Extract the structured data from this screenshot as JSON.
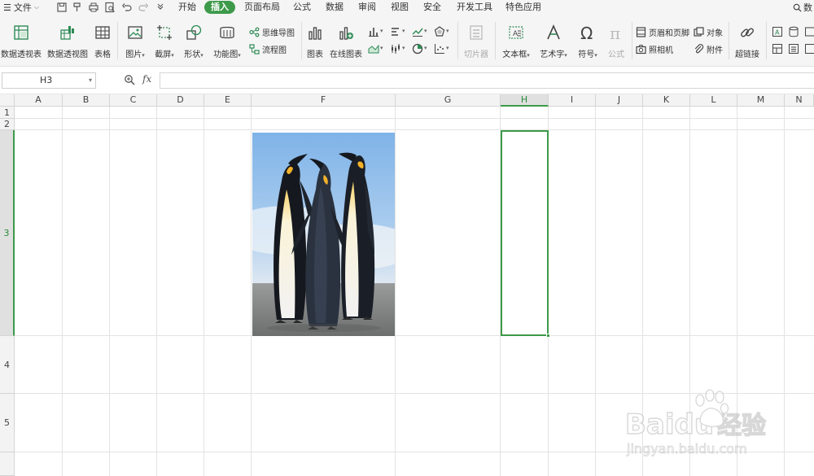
{
  "menubar": {
    "file_label": "文件",
    "tabs": [
      {
        "label": "开始",
        "active": false
      },
      {
        "label": "插入",
        "active": true
      },
      {
        "label": "页面布局",
        "active": false
      },
      {
        "label": "公式",
        "active": false
      },
      {
        "label": "数据",
        "active": false
      },
      {
        "label": "审阅",
        "active": false
      },
      {
        "label": "视图",
        "active": false
      },
      {
        "label": "安全",
        "active": false
      },
      {
        "label": "开发工具",
        "active": false
      },
      {
        "label": "特色应用",
        "active": false
      }
    ],
    "search_label": "数",
    "quick_access_icons": [
      "save-icon",
      "format-painter-icon",
      "print-icon",
      "print-preview-icon",
      "undo-icon",
      "redo-icon",
      "customize-icon"
    ]
  },
  "ribbon": {
    "pivot_table": "数据透视表",
    "pivot_chart": "数据透视图",
    "table": "表格",
    "picture": "图片",
    "screenshot": "截屏",
    "shapes": "形状",
    "function_chart": "功能图",
    "mind_map": "思维导图",
    "flowchart": "流程图",
    "chart": "图表",
    "online_chart": "在线图表",
    "slicer": "切片器",
    "text_box": "文本框",
    "word_art": "艺术字",
    "symbol": "符号",
    "equation": "公式",
    "header_footer": "页眉和页脚",
    "object": "对象",
    "camera": "照相机",
    "attachment": "附件",
    "hyperlink": "超链接"
  },
  "formula_bar": {
    "cell_ref": "H3",
    "fx_label": "fx",
    "formula": ""
  },
  "sheet": {
    "columns": [
      "A",
      "B",
      "C",
      "D",
      "E",
      "F",
      "G",
      "H",
      "I",
      "J",
      "K",
      "L",
      "M",
      "N"
    ],
    "selected_column": "H",
    "rows": [
      "1",
      "2",
      "3",
      "4",
      "5"
    ],
    "selected_row": "3",
    "picture_subject": "penguins-photo"
  },
  "watermark": {
    "brand": "Baidu",
    "brand_cn": "经验",
    "url": "jingyan.baidu.com"
  },
  "colors": {
    "accent": "#3d9a4a",
    "ribbon_bg": "#f5f5f5",
    "grid_line": "#e3e3e3"
  }
}
